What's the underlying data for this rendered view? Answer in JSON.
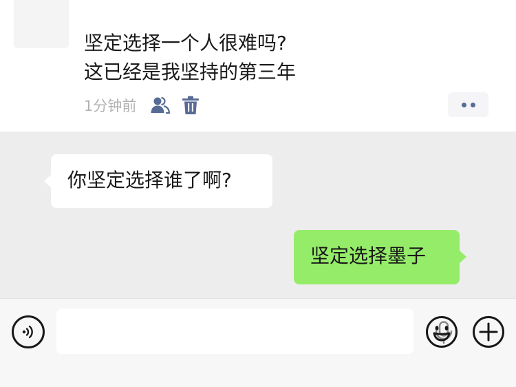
{
  "post": {
    "lines": [
      "坚定选择一个人很难吗?",
      "这已经是我坚持的第三年"
    ],
    "time": "1分钟前",
    "icons": [
      "contacts-visibility-icon",
      "trash-icon",
      "more-dots-icon"
    ]
  },
  "chat": {
    "incoming": "你坚定选择谁了啊?",
    "outgoing": "坚定选择墨子"
  },
  "input_bar": {
    "value": "",
    "placeholder": "",
    "icons": [
      "voice-icon",
      "microphone-icon",
      "emoji-icon",
      "plus-icon"
    ]
  },
  "colors": {
    "link_blue": "#576b95",
    "outgoing_bubble": "#95ec69",
    "chat_bg": "#ededed",
    "time_gray": "#b2b2b2"
  }
}
